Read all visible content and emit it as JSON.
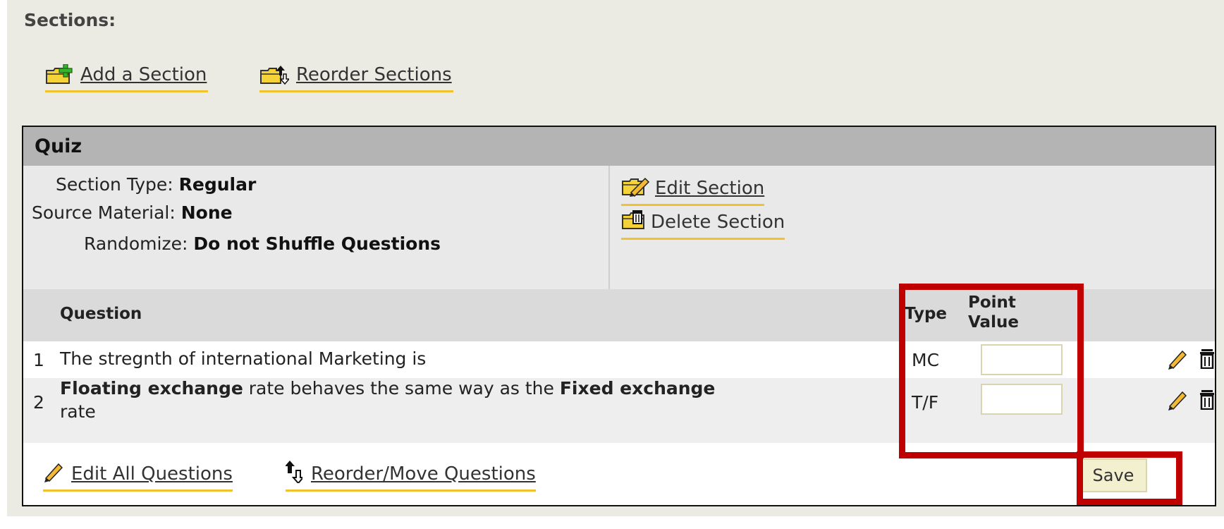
{
  "sections": {
    "heading": "Sections:",
    "add_label": "Add a Section",
    "reorder_label": "Reorder Sections"
  },
  "quiz": {
    "title": "Quiz",
    "info": {
      "section_type_label": "Section Type:",
      "section_type_value": "Regular",
      "source_label": "Source Material:",
      "source_value": "None",
      "randomize_label": "Randomize:",
      "randomize_value": "Do not Shuffle Questions"
    },
    "edit_section_label": "Edit Section",
    "delete_section_label": "Delete Section",
    "columns": {
      "question": "Question",
      "type": "Type",
      "point_value_line1": "Point",
      "point_value_line2": "Value"
    },
    "questions": [
      {
        "number": "1",
        "text_plain": "The stregnth of international Marketing is",
        "type": "MC",
        "point_value": ""
      },
      {
        "number": "2",
        "text_bold1": "Floating exchange",
        "text_mid": " rate behaves the same way as the ",
        "text_bold2": "Fixed exchange",
        "text_line2": "rate",
        "type": "T/F",
        "point_value": ""
      }
    ],
    "edit_all_label": "Edit All Questions",
    "reorder_move_label": "Reorder/Move Questions",
    "save_label": "Save"
  },
  "colors": {
    "accent_underline": "#f0c22e",
    "highlight": "#c00000",
    "header_bg": "#b4b4b4"
  },
  "icons": [
    "folder-add-icon",
    "folder-reorder-icon",
    "edit-section-icon",
    "delete-section-icon",
    "pencil-icon",
    "trash-icon",
    "reorder-arrows-icon"
  ]
}
